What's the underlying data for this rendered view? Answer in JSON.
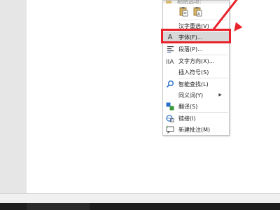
{
  "colors": {
    "accent": "#e8222b",
    "hover": "#d8d8d8",
    "menu_bg": "#ffffff"
  },
  "context_menu": {
    "top_cut_label": "粘贴选项:",
    "paste_options": [
      {
        "name": "paste-keep-formatting-icon"
      },
      {
        "name": "paste-text-only-icon"
      }
    ],
    "items": [
      {
        "label": "汉字重选(V)",
        "icon": "",
        "highlighted": false,
        "submenu": false
      },
      {
        "label": "字体(F)...",
        "icon": "font-icon",
        "highlighted": true,
        "submenu": false
      },
      {
        "label": "段落(P)...",
        "icon": "paragraph-icon",
        "highlighted": false,
        "submenu": false
      },
      {
        "label": "文字方向(X)...",
        "icon": "text-direction-icon",
        "highlighted": false,
        "submenu": false
      },
      {
        "label": "插入符号(S)",
        "icon": "",
        "highlighted": false,
        "submenu": false
      },
      {
        "label": "智能查找(L)",
        "icon": "smart-lookup-icon",
        "highlighted": false,
        "submenu": false
      },
      {
        "label": "同义词(Y)",
        "icon": "",
        "highlighted": false,
        "submenu": true
      },
      {
        "label": "翻译(S)",
        "icon": "translate-icon",
        "highlighted": false,
        "submenu": false
      },
      {
        "label": "链接(I)",
        "icon": "link-icon",
        "highlighted": false,
        "submenu": false
      },
      {
        "label": "新建批注(M)",
        "icon": "new-comment-icon",
        "highlighted": false,
        "submenu": false
      }
    ]
  }
}
